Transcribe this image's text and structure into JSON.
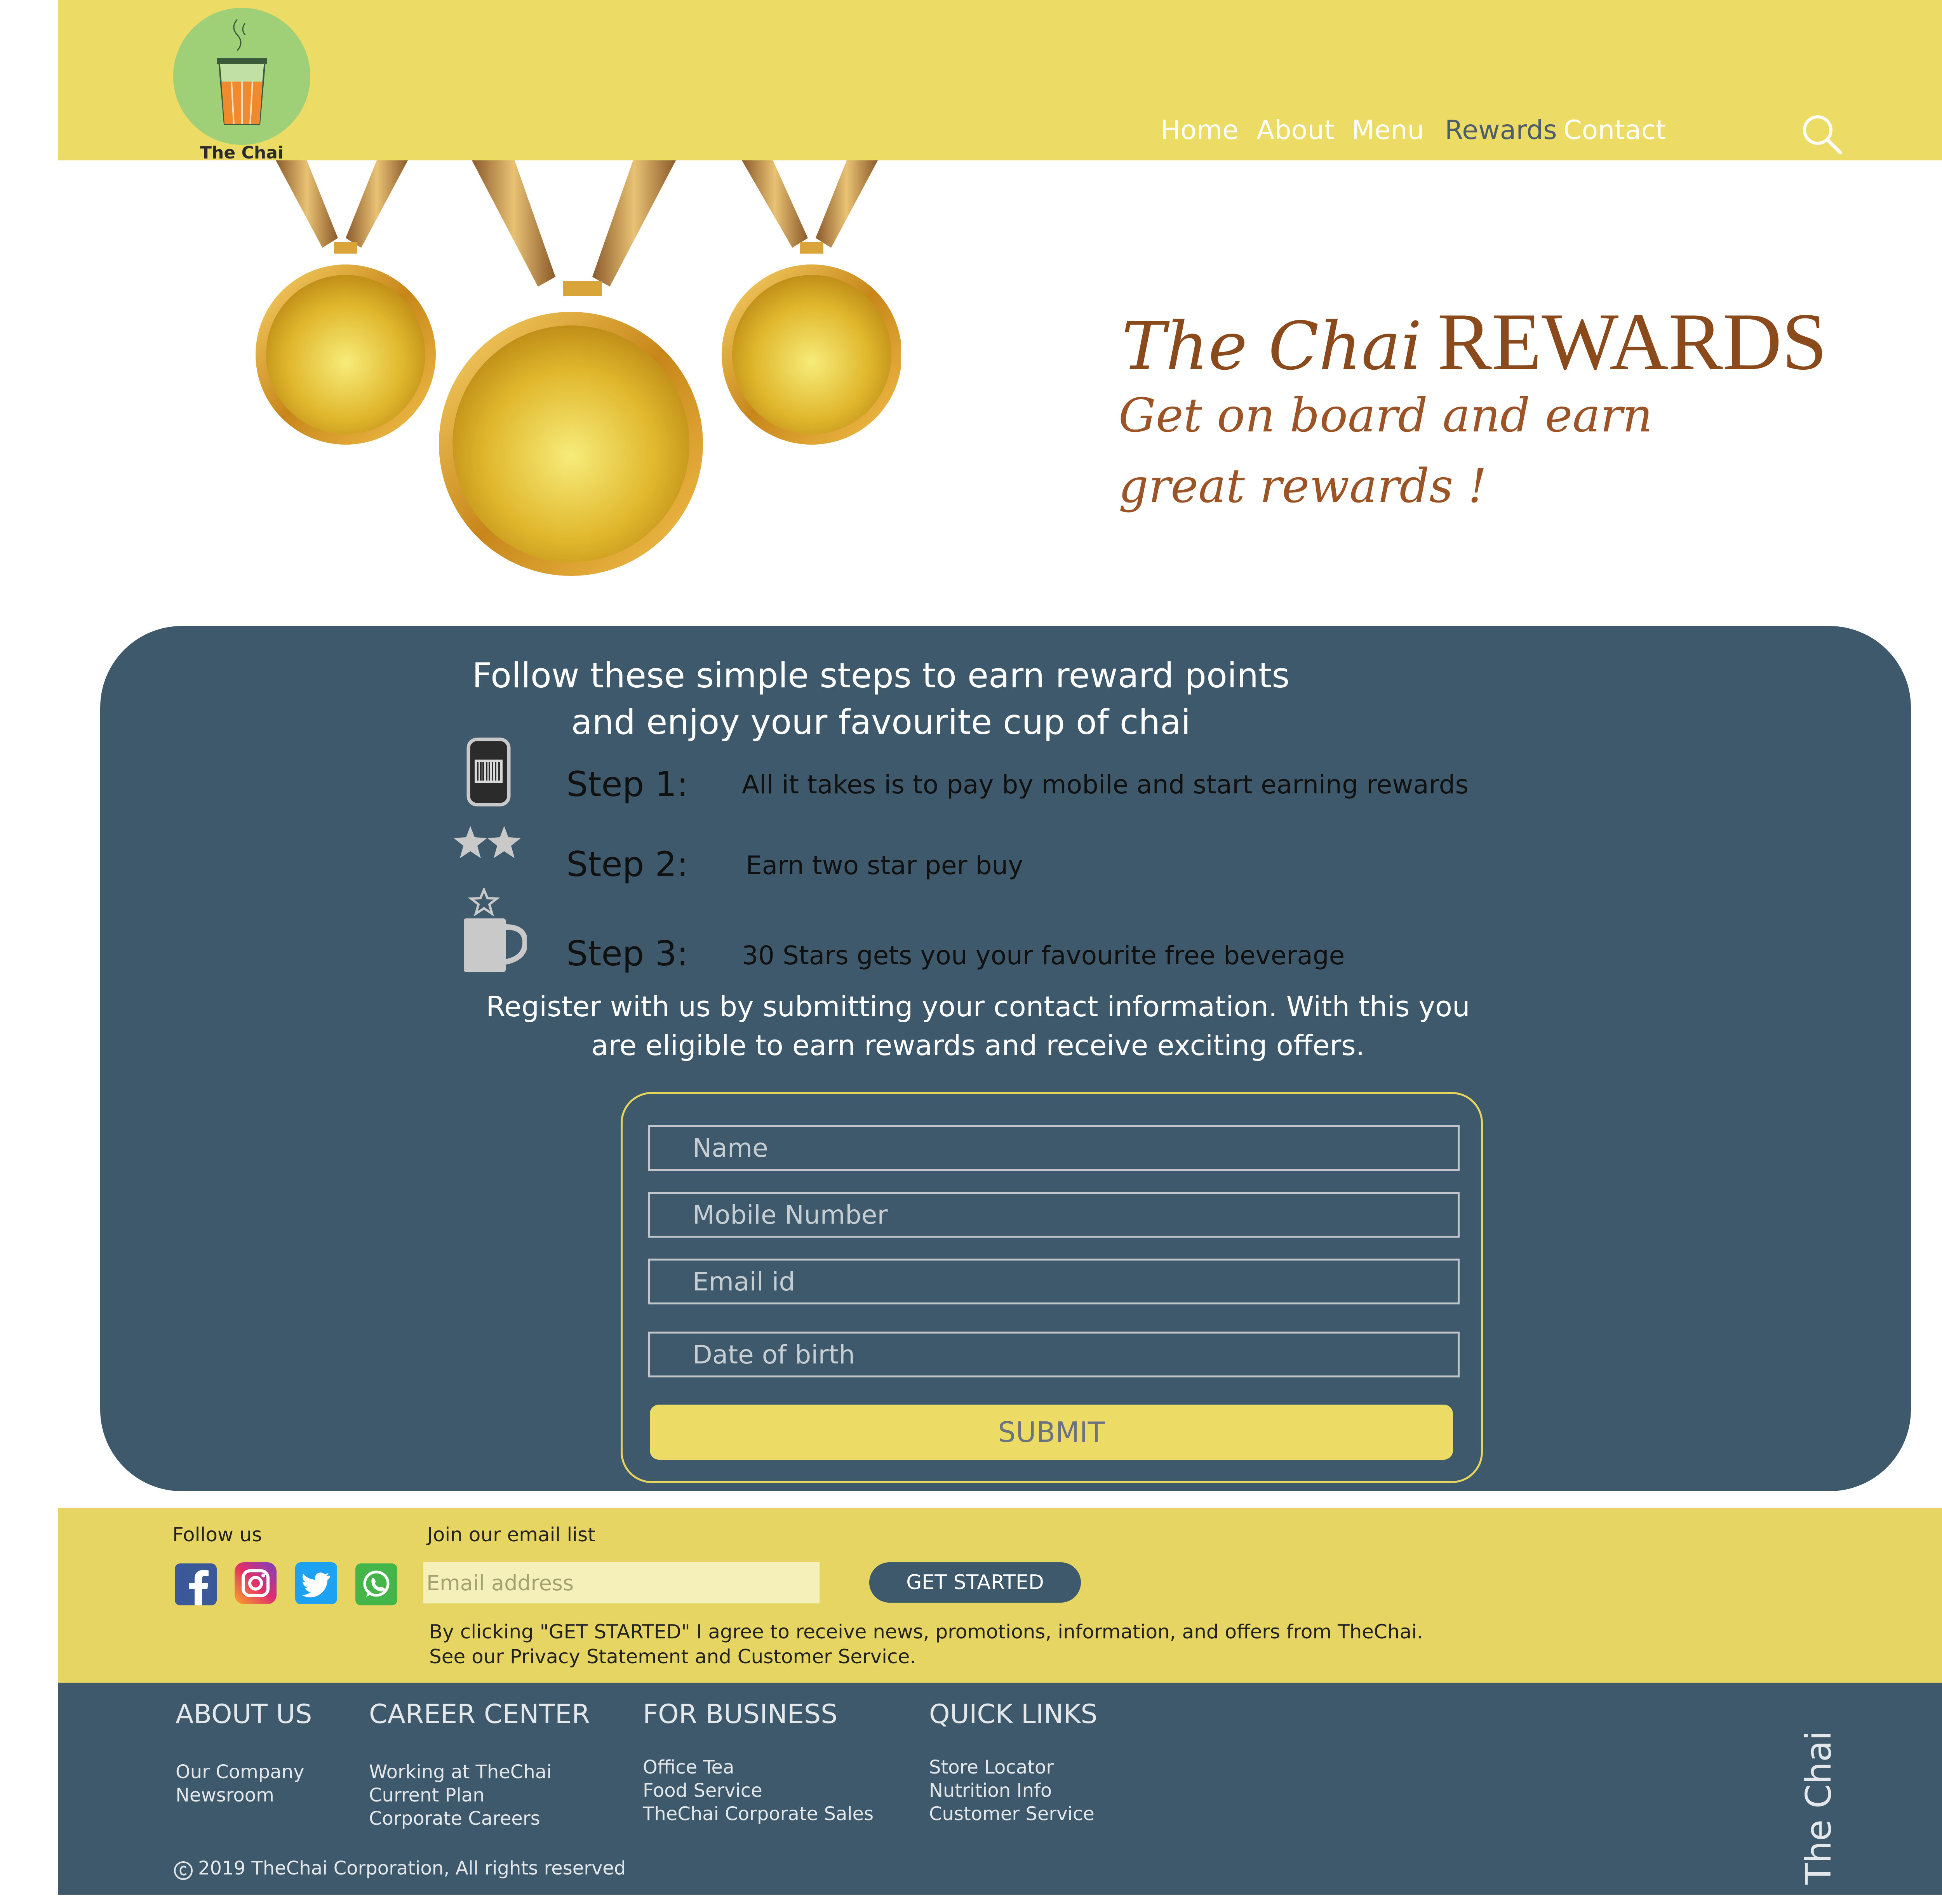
{
  "header": {
    "logo_text": "The Chai",
    "nav": {
      "home": "Home",
      "about": "About",
      "menu": "Menu",
      "rewards": "Rewards",
      "contact": "Contact"
    },
    "active_nav": "Rewards",
    "search_icon": "search-icon"
  },
  "hero": {
    "title_part1": "The Chai",
    "title_part2": "REWARDS",
    "subtitle": "Get on board and earn great rewards !",
    "image": "gold-medals"
  },
  "steps": {
    "heading_line1": "Follow these simple steps to earn reward points",
    "heading_line2": "and enjoy your favourite cup of chai",
    "items": [
      {
        "label": "Step 1:",
        "text": "All it takes is to pay by mobile and start earning rewards",
        "icon": "mobile-barcode-icon"
      },
      {
        "label": "Step 2:",
        "text": "Earn two star per buy",
        "icon": "two-stars-icon"
      },
      {
        "label": "Step 3:",
        "text": "30 Stars gets you your favourite free beverage",
        "icon": "cup-star-icon"
      }
    ],
    "register_line1": "Register with us by submitting your contact information. With this you",
    "register_line2": "are eligible to earn rewards and receive exciting offers."
  },
  "form": {
    "name_placeholder": "Name",
    "mobile_placeholder": "Mobile Number",
    "email_placeholder": "Email id",
    "dob_placeholder": "Date of birth",
    "submit_label": "SUBMIT"
  },
  "footer_band": {
    "follow_label": "Follow us",
    "social_icons": [
      "facebook-icon",
      "instagram-icon",
      "twitter-icon",
      "whatsapp-icon"
    ],
    "join_label": "Join our email list",
    "email_placeholder": "Email address",
    "get_started_label": "GET STARTED",
    "disclaimer_line1": "By clicking \"GET STARTED\" I agree to receive news, promotions, information, and offers from TheChai.",
    "disclaimer_line2": "See our Privacy Statement and Customer Service."
  },
  "footer": {
    "columns": [
      {
        "heading": "ABOUT US",
        "links": [
          "Our Company",
          "Newsroom"
        ]
      },
      {
        "heading": "CAREER CENTER",
        "links": [
          "Working at TheChai",
          "Current Plan",
          "Corporate Careers"
        ]
      },
      {
        "heading": "FOR BUSINESS",
        "links": [
          "Office Tea",
          "Food Service",
          "TheChai Corporate Sales"
        ]
      },
      {
        "heading": "QUICK LINKS",
        "links": [
          "Store Locator",
          "Nutrition Info",
          "Customer Service"
        ]
      }
    ],
    "copyright": "2019 TheChai Corporation, All rights reserved",
    "brand_vertical": "The Chai"
  },
  "colors": {
    "header_yellow": "#ecdb65",
    "panel_blue": "#3d596b",
    "title_brown": "#8b4a1c",
    "footer_yellow": "#e6d562"
  }
}
